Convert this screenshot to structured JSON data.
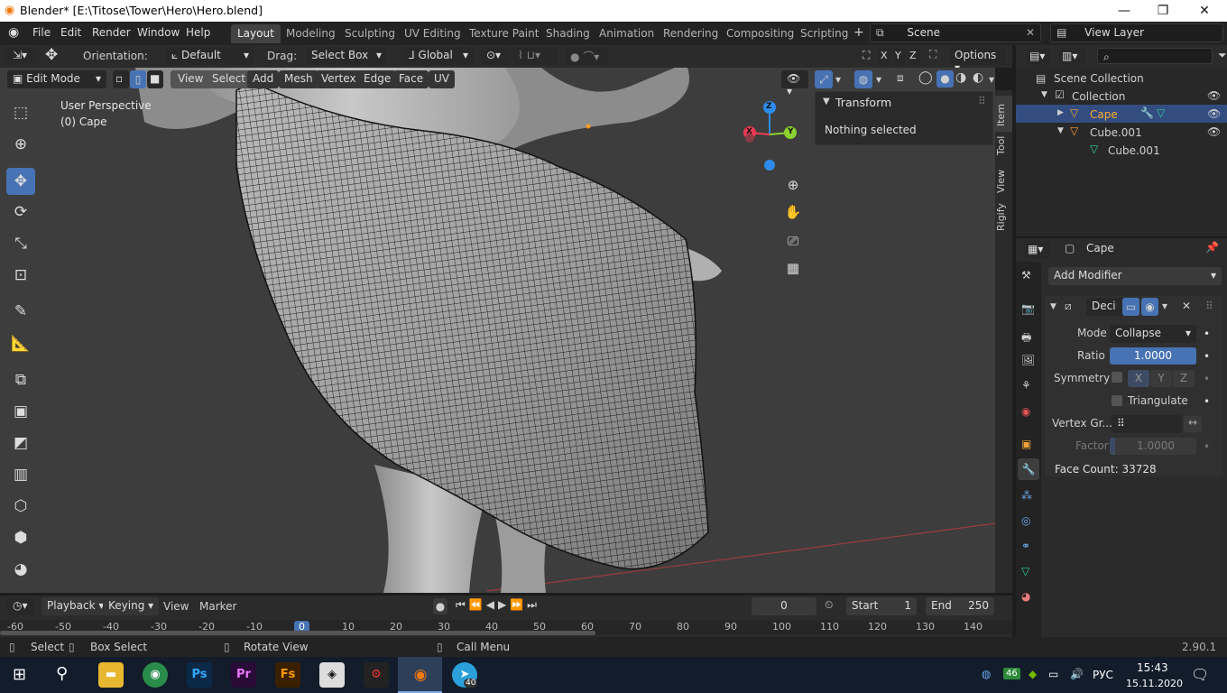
{
  "window": {
    "title": "Blender* [E:\\Titose\\Tower\\Hero\\Hero.blend]"
  },
  "menu": [
    "File",
    "Edit",
    "Render",
    "Window",
    "Help"
  ],
  "workspaces": [
    "Layout",
    "Modeling",
    "Sculpting",
    "UV Editing",
    "Texture Paint",
    "Shading",
    "Animation",
    "Rendering",
    "Compositing",
    "Scripting"
  ],
  "scene": {
    "name": "Scene",
    "view_layer": "View Layer"
  },
  "toolheader": {
    "orientation_label": "Orientation:",
    "orientation_value": "Default",
    "drag_label": "Drag:",
    "drag_value": "Select Box",
    "transform": "Global",
    "options": "Options",
    "axes": [
      "X",
      "Y",
      "Z"
    ]
  },
  "editheader": {
    "mode": "Edit Mode",
    "menus": [
      "View",
      "Select",
      "Add",
      "Mesh",
      "Vertex",
      "Edge",
      "Face",
      "UV"
    ]
  },
  "viewport": {
    "perspective": "User Perspective",
    "object": "(0) Cape"
  },
  "gizmo": {
    "x": "X",
    "y": "Y",
    "z": "Z"
  },
  "npanel": {
    "title": "Transform",
    "text": "Nothing selected",
    "tabs": [
      "Item",
      "Tool",
      "View",
      "Rigify"
    ]
  },
  "outliner": {
    "root": "Scene Collection",
    "collection": "Collection",
    "items": [
      "Cape",
      "Cube.001",
      "Cube.001"
    ]
  },
  "properties": {
    "object": "Cape",
    "add_modifier": "Add Modifier",
    "modifier_name": "Deci",
    "mode_label": "Mode",
    "mode_value": "Collapse",
    "ratio_label": "Ratio",
    "ratio_value": "1.0000",
    "ratio_fraction": 1.0,
    "symmetry_label": "Symmetry",
    "sym_axes": [
      "X",
      "Y",
      "Z"
    ],
    "triangulate_label": "Triangulate",
    "vgroup_label": "Vertex Gr...",
    "factor_label": "Factor",
    "factor_value": "1.0000",
    "face_count": "Face Count: 33728"
  },
  "timeline": {
    "menus": [
      "Playback",
      "Keying",
      "View",
      "Marker"
    ],
    "current_frame": "0",
    "start_label": "Start",
    "start": "1",
    "end_label": "End",
    "end": "250",
    "ruler": [
      "-60",
      "-50",
      "-40",
      "-30",
      "-20",
      "-10",
      "0",
      "10",
      "20",
      "30",
      "40",
      "50",
      "60",
      "70",
      "80",
      "90",
      "100",
      "110",
      "120",
      "130",
      "140"
    ]
  },
  "statusbar": {
    "select": "Select",
    "box_select": "Box Select",
    "rotate_view": "Rotate View",
    "call_menu": "Call Menu",
    "version": "2.90.1"
  },
  "taskbar": {
    "lang": "РУС",
    "time": "15:43",
    "date": "15.11.2020",
    "badge": "46",
    "tg_badge": "40"
  },
  "colors": {
    "accent": "#4772b3",
    "active_orange": "#ffaf29",
    "x_axis": "#ee3c54",
    "y_axis": "#8bd12f",
    "z_axis": "#2d8ceb"
  }
}
